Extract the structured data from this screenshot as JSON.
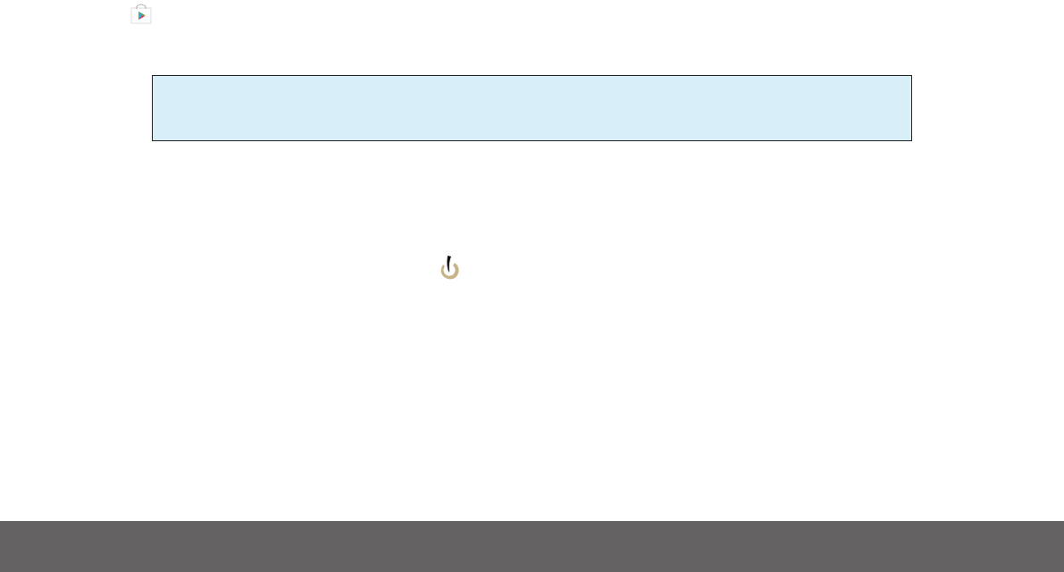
{
  "notice_box": {
    "shown": true
  },
  "footer": {
    "shown": true
  }
}
